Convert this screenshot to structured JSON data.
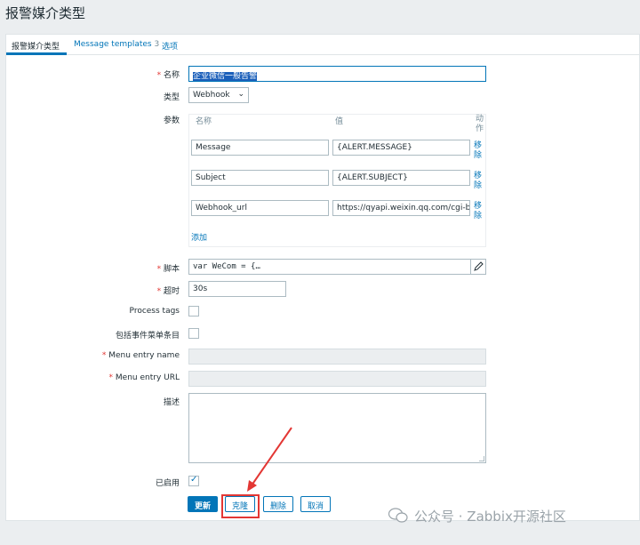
{
  "page": {
    "title": "报警媒介类型"
  },
  "tabs": [
    {
      "label": "报警媒介类型"
    },
    {
      "label": "Message templates",
      "count": "3"
    },
    {
      "label": "选项"
    }
  ],
  "form": {
    "name": {
      "label": "名称",
      "value": "企业微信一般告警"
    },
    "type": {
      "label": "类型",
      "value": "Webhook"
    },
    "params": {
      "label": "参数",
      "col_name": "名称",
      "col_value": "值",
      "col_action": "动作",
      "rows": [
        {
          "name": "Message",
          "value": "{ALERT.MESSAGE}",
          "remove": "移除"
        },
        {
          "name": "Subject",
          "value": "{ALERT.SUBJECT}",
          "remove": "移除"
        },
        {
          "name": "Webhook_url",
          "value": "https://qyapi.weixin.qq.com/cgi-bin/we",
          "remove": "移除"
        }
      ],
      "add": "添加"
    },
    "script": {
      "label": "脚本",
      "value": "var WeCom = {…"
    },
    "timeout": {
      "label": "超时",
      "value": "30s"
    },
    "process_tags": {
      "label": "Process tags",
      "checked": false
    },
    "include_menu": {
      "label": "包括事件菜单条目",
      "checked": false
    },
    "menu_entry_name": {
      "label": "Menu entry name",
      "value": ""
    },
    "menu_entry_url": {
      "label": "Menu entry URL",
      "value": ""
    },
    "description": {
      "label": "描述",
      "value": ""
    },
    "enabled": {
      "label": "已启用",
      "checked": true
    }
  },
  "buttons": {
    "update": "更新",
    "clone": "克隆",
    "delete": "删除",
    "cancel": "取消"
  },
  "watermark": {
    "text": "公众号 · Zabbix开源社区"
  },
  "colors": {
    "accent": "#0275b8",
    "required": "#e33734",
    "annotation": "#e33734"
  }
}
